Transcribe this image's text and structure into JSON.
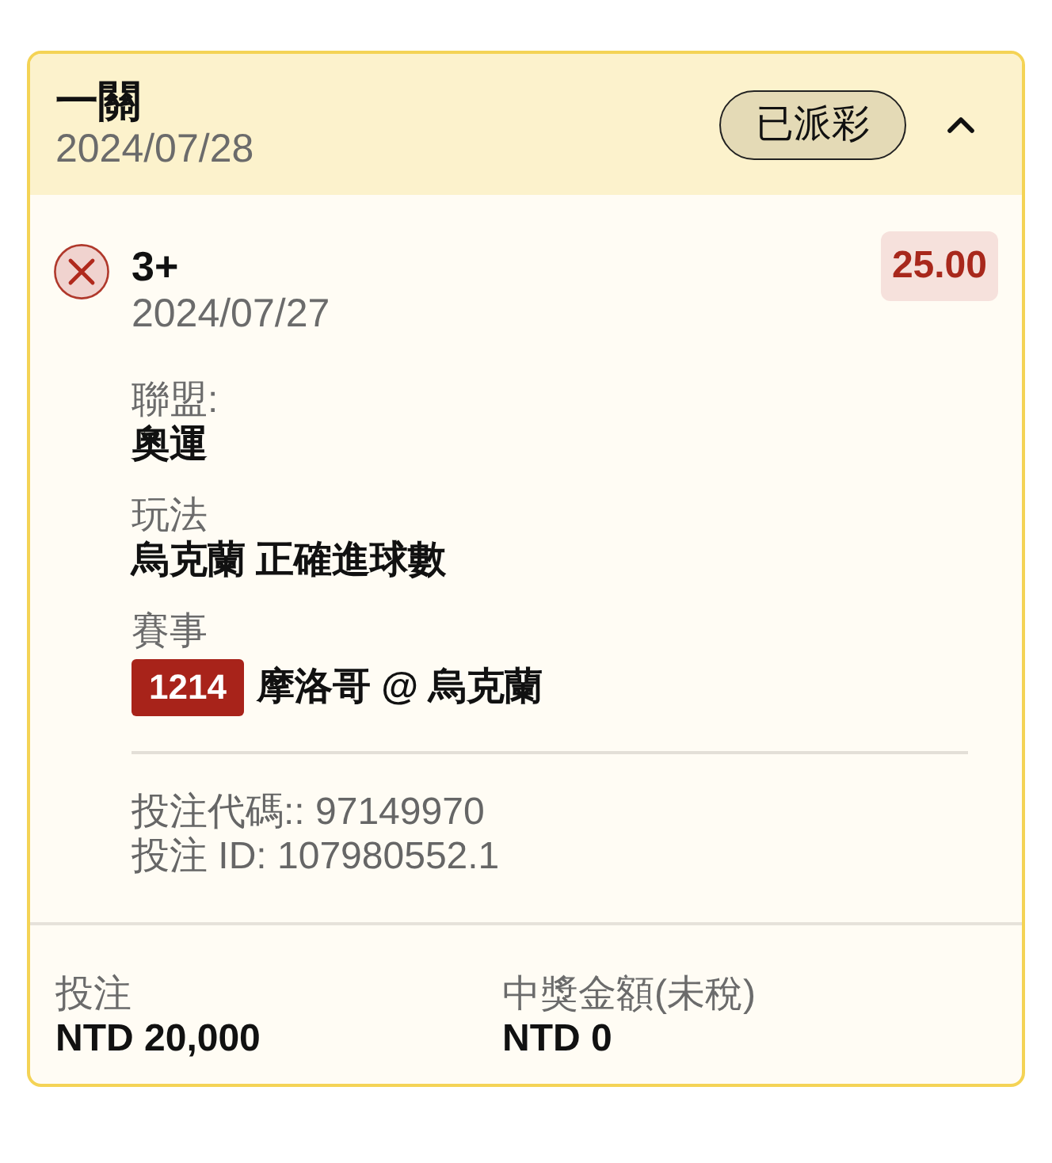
{
  "bet": {
    "title": "一關",
    "date": "2024/07/28",
    "status_badge": "已派彩",
    "expanded": true,
    "selection": {
      "kind": "lost",
      "name": "3+",
      "date": "2024/07/27",
      "odds": "25.00",
      "fields": [
        {
          "kind": "text",
          "label": "聯盟:",
          "value": "奧運"
        },
        {
          "kind": "text",
          "label": "玩法",
          "value": "烏克蘭 正確進球數"
        },
        {
          "kind": "match",
          "label": "賽事",
          "match_code": "1214",
          "value": "摩洛哥 @ 烏克蘭"
        }
      ],
      "codes": [
        "投注代碼:: 97149970",
        "投注 ID: 107980552.1"
      ]
    },
    "summary": [
      {
        "label": "投注",
        "value": "NTD 20,000"
      },
      {
        "label": "中獎金額(未稅)",
        "value": "NTD 0"
      }
    ]
  }
}
